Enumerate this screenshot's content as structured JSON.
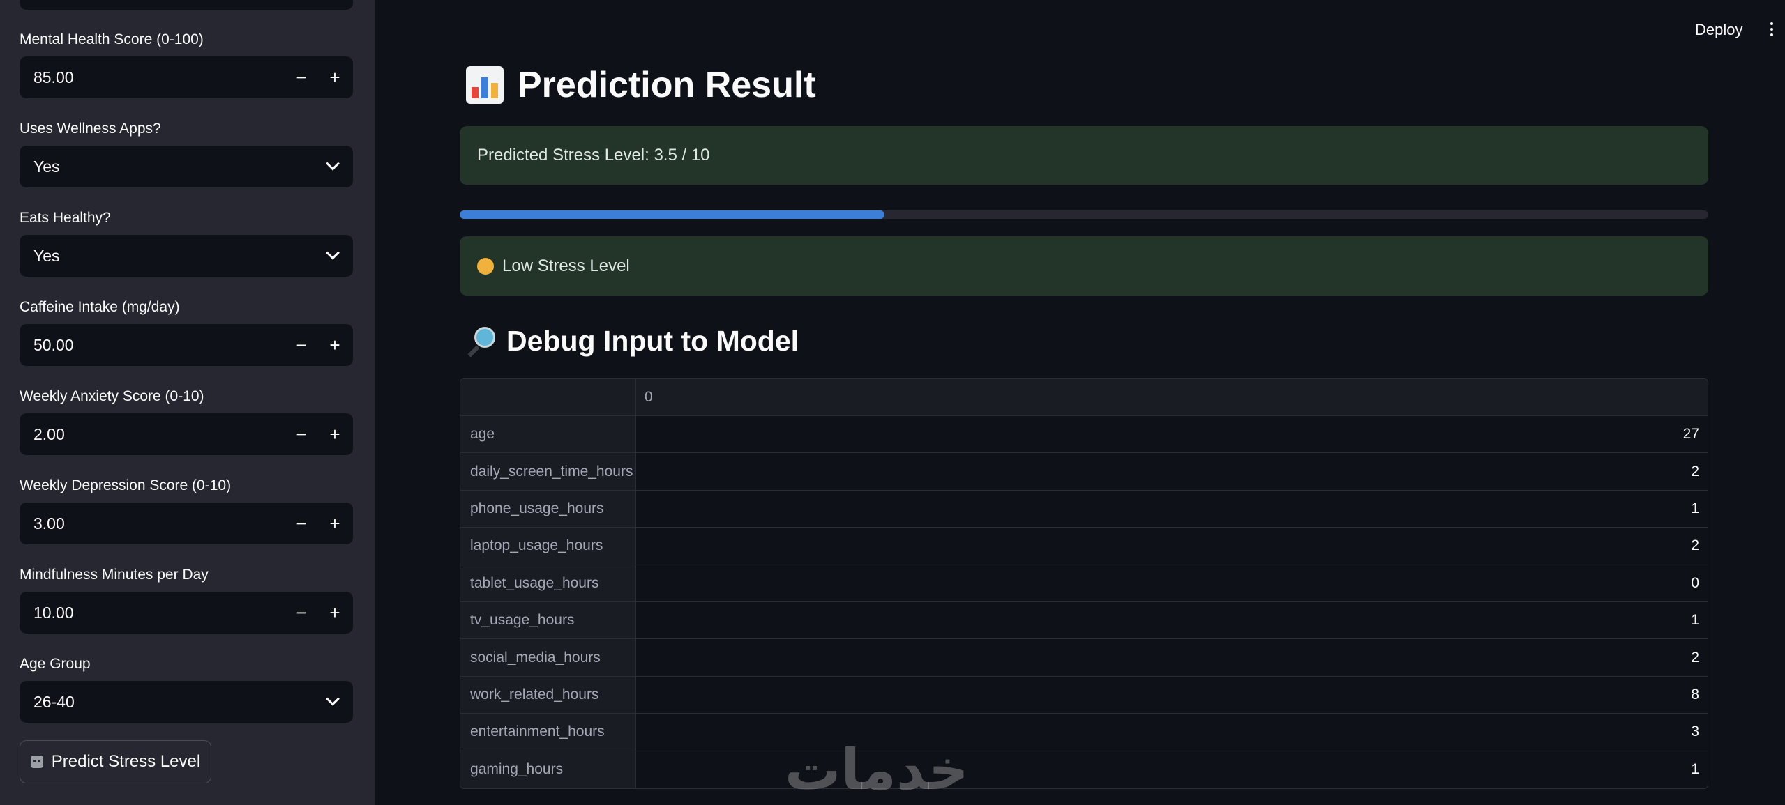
{
  "header": {
    "deploy_label": "Deploy",
    "menu_icon": "kebab-menu-icon"
  },
  "sidebar": {
    "fields": [
      {
        "label": "Mental Health Score (0-100)",
        "type": "number",
        "value": "85.00"
      },
      {
        "label": "Uses Wellness Apps?",
        "type": "select",
        "value": "Yes"
      },
      {
        "label": "Eats Healthy?",
        "type": "select",
        "value": "Yes"
      },
      {
        "label": "Caffeine Intake (mg/day)",
        "type": "number",
        "value": "50.00"
      },
      {
        "label": "Weekly Anxiety Score (0-10)",
        "type": "number",
        "value": "2.00"
      },
      {
        "label": "Weekly Depression Score (0-10)",
        "type": "number",
        "value": "3.00"
      },
      {
        "label": "Mindfulness Minutes per Day",
        "type": "number",
        "value": "10.00"
      },
      {
        "label": "Age Group",
        "type": "select",
        "value": "26-40"
      }
    ],
    "minus_symbol": "−",
    "plus_symbol": "+",
    "predict_button": "Predict Stress Level"
  },
  "main": {
    "title": "Prediction Result",
    "prediction_text": "Predicted Stress Level: 3.5 / 10",
    "progress_fraction": 0.34,
    "stress_label": "Low Stress Level",
    "debug_title": "Debug Input to Model",
    "table": {
      "column_header": "0",
      "rows": [
        {
          "name": "age",
          "value": "27"
        },
        {
          "name": "daily_screen_time_hours",
          "value": "2"
        },
        {
          "name": "phone_usage_hours",
          "value": "1"
        },
        {
          "name": "laptop_usage_hours",
          "value": "2"
        },
        {
          "name": "tablet_usage_hours",
          "value": "0"
        },
        {
          "name": "tv_usage_hours",
          "value": "1"
        },
        {
          "name": "social_media_hours",
          "value": "2"
        },
        {
          "name": "work_related_hours",
          "value": "8"
        },
        {
          "name": "entertainment_hours",
          "value": "3"
        },
        {
          "name": "gaming_hours",
          "value": "1"
        }
      ]
    }
  },
  "watermark": "خدمات",
  "colors": {
    "background": "#0e1117",
    "sidebar": "#262730",
    "success_bg": "#223528",
    "progress": "#3b7fd9"
  }
}
